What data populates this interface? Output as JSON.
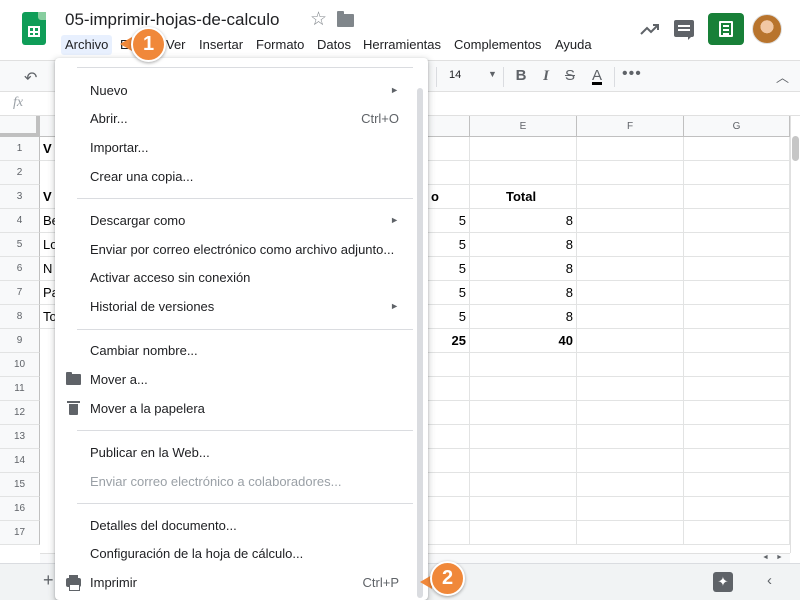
{
  "document": {
    "title": "05-imprimir-hojas-de-calculo"
  },
  "menubar": {
    "archivo": "Archivo",
    "editar": "E",
    "ver": "Ver",
    "insertar": "Insertar",
    "formato": "Formato",
    "datos": "Datos",
    "herramientas": "Herramientas",
    "complementos": "Complementos",
    "ayuda": "Ayuda"
  },
  "toolbar": {
    "font_size": "14",
    "bold": "B",
    "italic": "I",
    "strike": "S",
    "text_color": "A",
    "more": "•••"
  },
  "formula_bar": {
    "fx": "fx"
  },
  "grid": {
    "columns": {
      "e": "E",
      "f": "F",
      "g": "G"
    },
    "rows": [
      "1",
      "2",
      "3",
      "4",
      "5",
      "6",
      "7",
      "8",
      "9",
      "10",
      "11",
      "12",
      "13",
      "14",
      "15",
      "16",
      "17"
    ],
    "cells": {
      "a1": "V",
      "a3": "V",
      "d3_fragment": "o",
      "e3": "Total",
      "a4": "Be",
      "a5": "Lo",
      "a6": "N",
      "a7": "Pa",
      "a8": "To",
      "d4": "5",
      "d5": "5",
      "d6": "5",
      "d7": "5",
      "d8": "5",
      "d9": "25",
      "e4": "8",
      "e5": "8",
      "e6": "8",
      "e7": "8",
      "e8": "8",
      "e9": "40"
    }
  },
  "file_menu": {
    "nuevo": "Nuevo",
    "abrir": "Abrir...",
    "abrir_shortcut": "Ctrl+O",
    "importar": "Importar...",
    "crear_copia": "Crear una copia...",
    "descargar": "Descargar como",
    "enviar_adjunto": "Enviar por correo electrónico como archivo adjunto...",
    "sin_conexion": "Activar acceso sin conexión",
    "historial": "Historial de versiones",
    "cambiar_nombre": "Cambiar nombre...",
    "mover": "Mover a...",
    "papelera": "Mover a la papelera",
    "publicar": "Publicar en la Web...",
    "enviar_colaboradores": "Enviar correo electrónico a colaboradores...",
    "detalles": "Detalles del documento...",
    "configuracion": "Configuración de la hoja de cálculo...",
    "imprimir": "Imprimir",
    "imprimir_shortcut": "Ctrl+P",
    "submenu_arrow": "►"
  },
  "steps": {
    "one": "1",
    "two": "2"
  },
  "colors": {
    "badge": "#f0883a",
    "sheets_green": "#0f9d58",
    "share_green": "#188038"
  }
}
